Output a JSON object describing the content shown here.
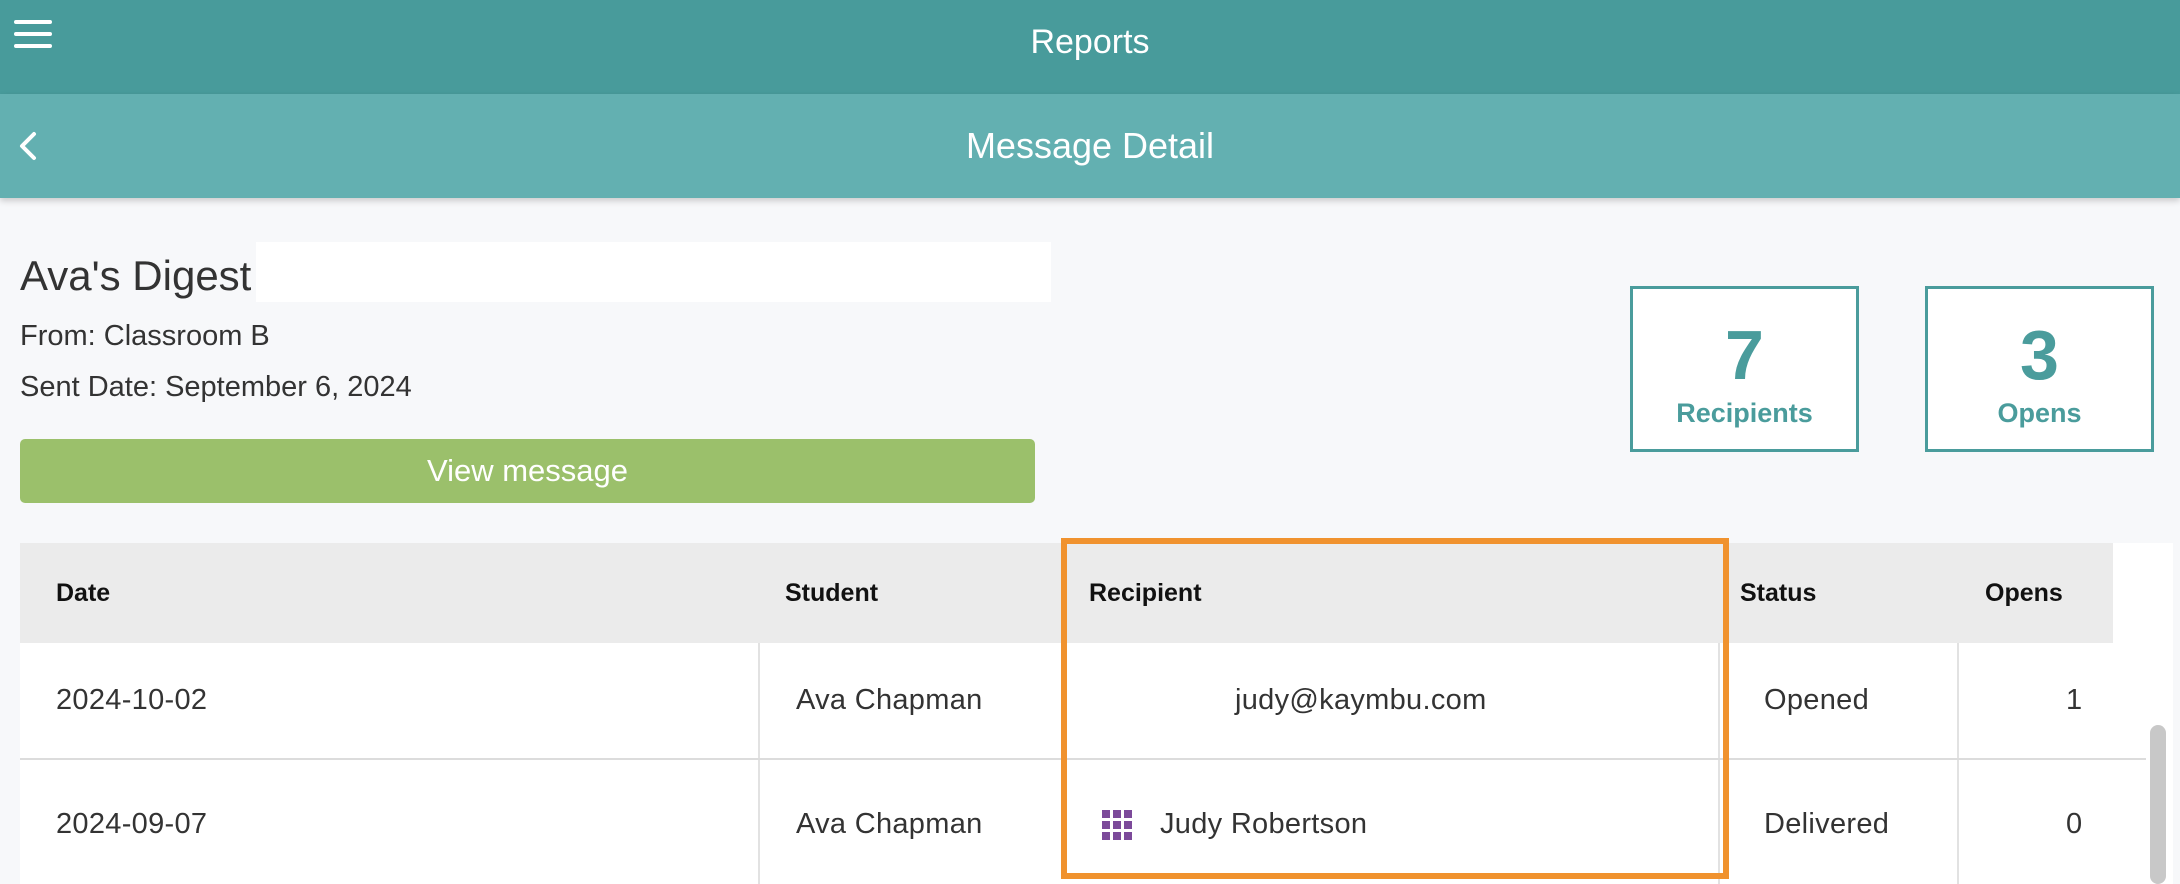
{
  "header": {
    "title": "Reports"
  },
  "subheader": {
    "title": "Message Detail"
  },
  "message": {
    "title": "Ava's Digest",
    "from": "From: Classroom B",
    "sent_date": "Sent Date: September 6, 2024",
    "view_button": "View message"
  },
  "stats": {
    "recipients": {
      "value": "7",
      "label": "Recipients"
    },
    "opens": {
      "value": "3",
      "label": "Opens"
    }
  },
  "table": {
    "columns": {
      "date": "Date",
      "student": "Student",
      "recipient": "Recipient",
      "status": "Status",
      "opens": "Opens"
    },
    "rows": [
      {
        "date": "2024-10-02",
        "student": "Ava Chapman",
        "recipient": "judy@kaymbu.com",
        "status": "Opened",
        "opens": "1"
      },
      {
        "date": "2024-09-07",
        "student": "Ava Chapman",
        "recipient": "Judy Robertson",
        "status": "Delivered",
        "opens": "0"
      }
    ]
  },
  "colors": {
    "topbar": "#489b9b",
    "subbar": "#63b0b1",
    "accent": "#4a9c9c",
    "button": "#9bc06b",
    "highlight": "#f0922e",
    "recipient_icon": "#7c4a9a"
  },
  "icons": {
    "menu": "hamburger-menu-icon",
    "back": "chevron-left-icon",
    "recipient_app": "grid-dots-icon"
  }
}
